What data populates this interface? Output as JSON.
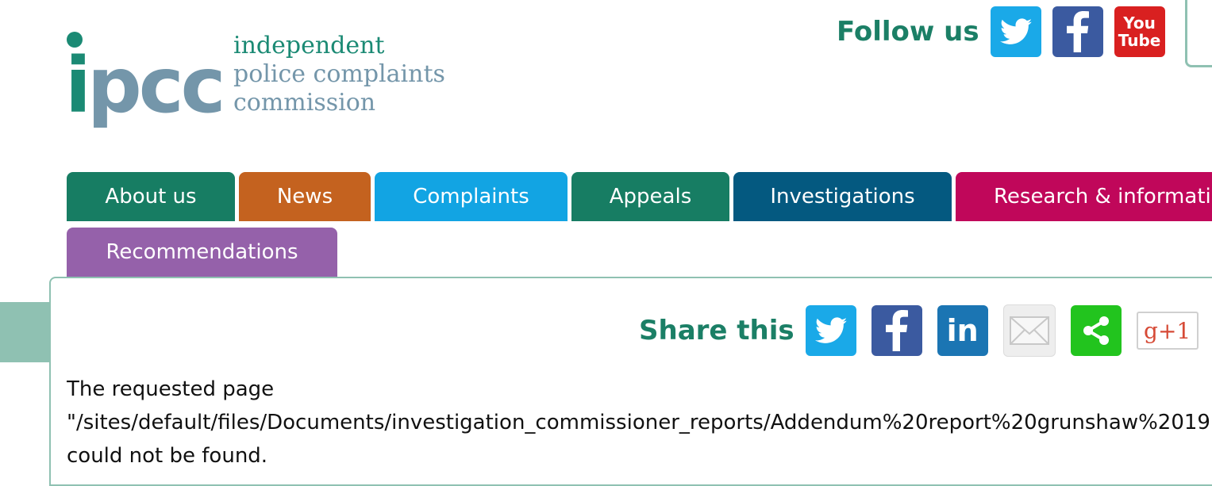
{
  "logo": {
    "acronym_i": "i",
    "acronym_rest": "pcc",
    "line1": "independent",
    "line2": "police complaints",
    "line3": "commission"
  },
  "follow": {
    "label": "Follow us",
    "icons": [
      "twitter-icon",
      "facebook-icon",
      "youtube-icon"
    ],
    "youtube_top": "You",
    "youtube_bottom": "Tube"
  },
  "nav": {
    "tabs": [
      {
        "label": "About us",
        "color": "#177d63"
      },
      {
        "label": "News",
        "color": "#c4621f"
      },
      {
        "label": "Complaints",
        "color": "#12a4e3"
      },
      {
        "label": "Appeals",
        "color": "#177d63"
      },
      {
        "label": "Investigations",
        "color": "#045980"
      },
      {
        "label": "Research & informati",
        "color": "#c0075a"
      },
      {
        "label": "Recommendations",
        "color": "#9561aa"
      }
    ]
  },
  "share": {
    "label": "Share this",
    "linkedin_text": "in",
    "gplus_text": "g+1",
    "icons": [
      "twitter-icon",
      "facebook-icon",
      "linkedin-icon",
      "email-icon",
      "share-icon",
      "google-plus-icon"
    ]
  },
  "message": {
    "line1": "The requested page",
    "line2": "\"/sites/default/files/Documents/investigation_commissioner_reports/Addendum%20report%20grunshaw%2019",
    "line3": "could not be found."
  },
  "colors": {
    "accent_green": "#1b7f66",
    "panel_border": "#8fc1b2"
  }
}
